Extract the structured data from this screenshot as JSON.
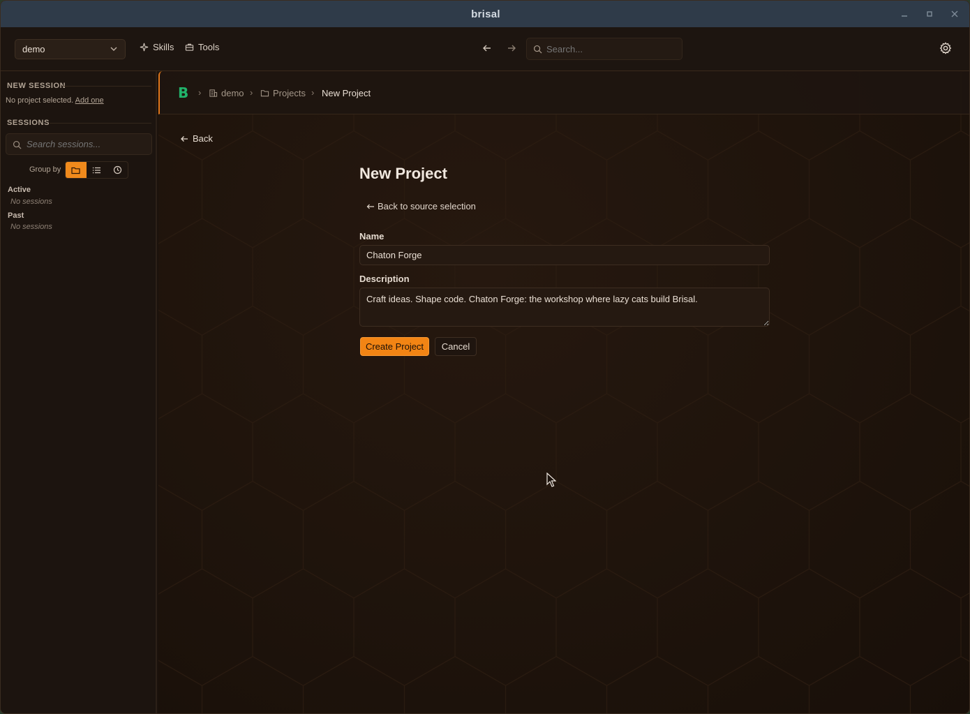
{
  "window": {
    "title": "brisal"
  },
  "appbar": {
    "project_selected": "demo",
    "skills_label": "Skills",
    "tools_label": "Tools",
    "search_placeholder": "Search..."
  },
  "sidebar": {
    "new_session_heading": "NEW SESSION",
    "no_project_text": "No project selected.",
    "add_one_link": "Add one",
    "sessions_heading": "SESSIONS",
    "search_placeholder": "Search sessions...",
    "group_by_label": "Group by",
    "group_by_options": [
      "folder-icon",
      "list-icon",
      "clock-icon"
    ],
    "group_by_active": "folder-icon",
    "groups": [
      {
        "title": "Active",
        "empty_text": "No sessions"
      },
      {
        "title": "Past",
        "empty_text": "No sessions"
      }
    ]
  },
  "breadcrumb": {
    "items": [
      "demo",
      "Projects",
      "New Project"
    ]
  },
  "main": {
    "back_label": "Back",
    "page_title": "New Project",
    "back_to_source_label": "Back to source selection",
    "name_label": "Name",
    "name_value": "Chaton Forge",
    "description_label": "Description",
    "description_value": "Craft ideas. Shape code. Chaton Forge: the workshop where lazy cats build Brisal.",
    "create_button": "Create Project",
    "cancel_button": "Cancel"
  },
  "colors": {
    "accent": "#f28414",
    "logo": "#21b36b",
    "titlebar": "#2f3b49",
    "background": "#1b120c"
  }
}
